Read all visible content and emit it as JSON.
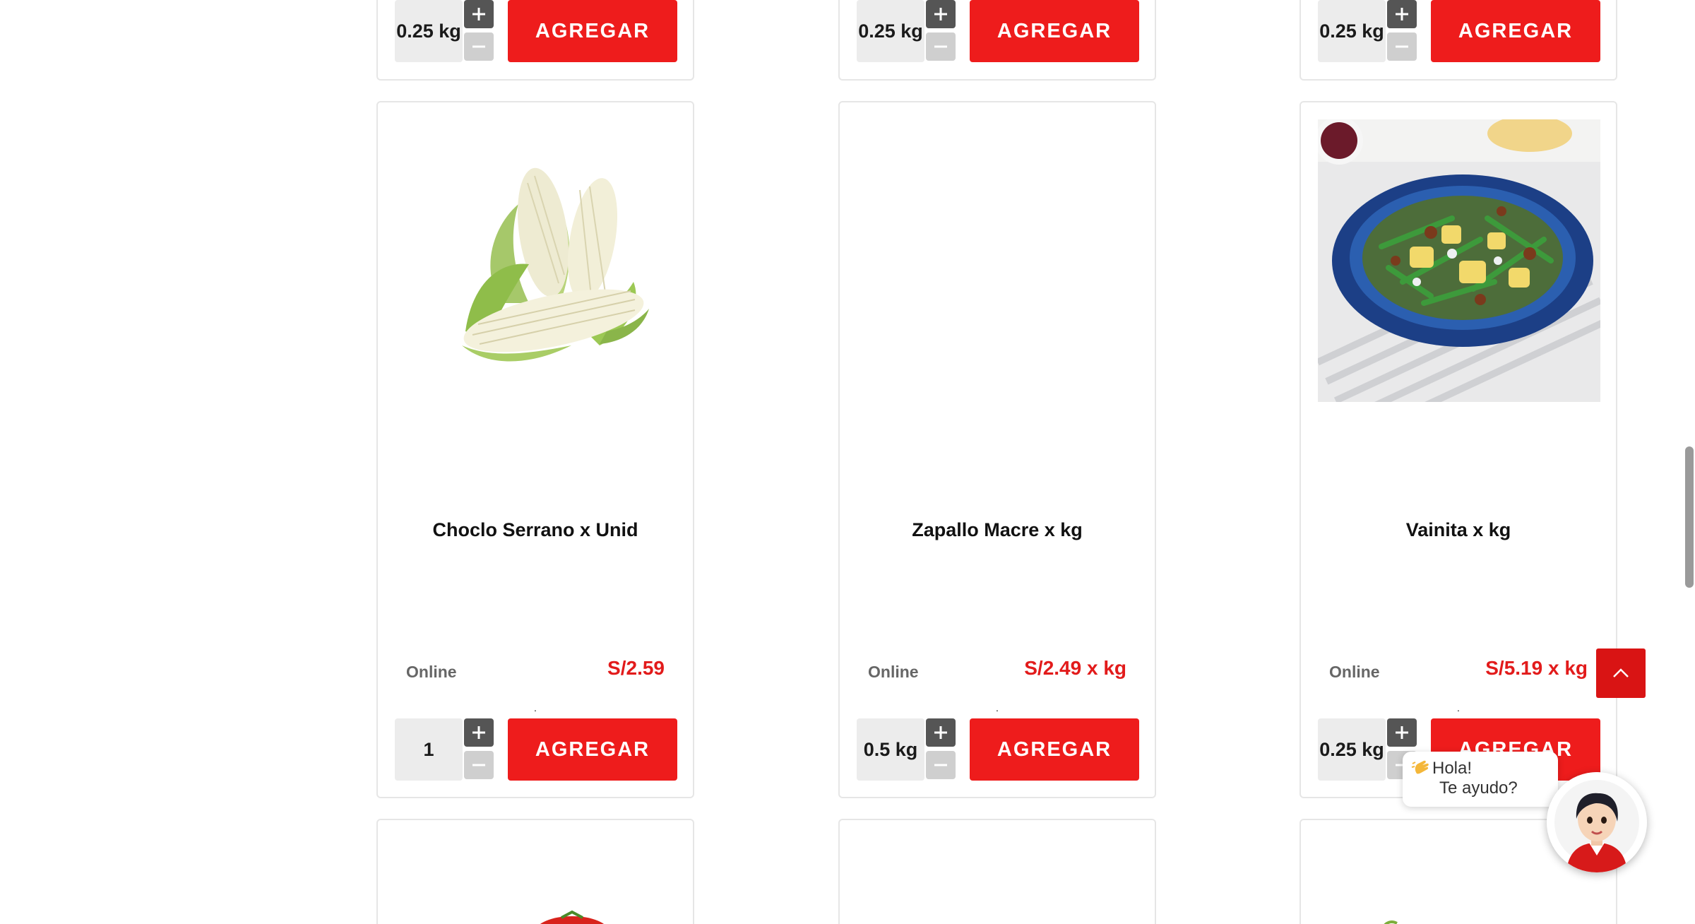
{
  "top_cards": [
    {
      "qty": "0.25 kg",
      "button_label": "AGREGAR"
    },
    {
      "qty": "0.25 kg",
      "button_label": "AGREGAR"
    },
    {
      "qty": "0.25 kg",
      "button_label": "AGREGAR"
    }
  ],
  "products": [
    {
      "name": "Choclo Serrano x Unid",
      "dot": ".",
      "availability": "Online",
      "price": "S/2.59",
      "qty": "1",
      "button_label": "AGREGAR",
      "image": "corn"
    },
    {
      "name": "Zapallo Macre x kg",
      "dot": ".",
      "availability": "Online",
      "price": "S/2.49 x kg",
      "qty": "0.5 kg",
      "button_label": "AGREGAR",
      "image": "none"
    },
    {
      "name": "Vainita x kg",
      "dot": ".",
      "availability": "Online",
      "price": "S/5.19 x kg",
      "qty": "0.25 kg",
      "button_label": "AGREGAR",
      "image": "green-bean-salad"
    }
  ],
  "chat": {
    "line1": "Hola!",
    "line2": "Te ayudo?"
  },
  "icons": {
    "increment": "plus-icon",
    "decrement": "minus-icon",
    "back_to_top": "chevron-up-icon",
    "greeting": "waving-hand-icon",
    "assistant": "assistant-avatar"
  },
  "colors": {
    "accent": "#ee1c1c",
    "price": "#e21b1b",
    "stepper_dark": "#555555",
    "stepper_light": "#cfcfcf"
  }
}
